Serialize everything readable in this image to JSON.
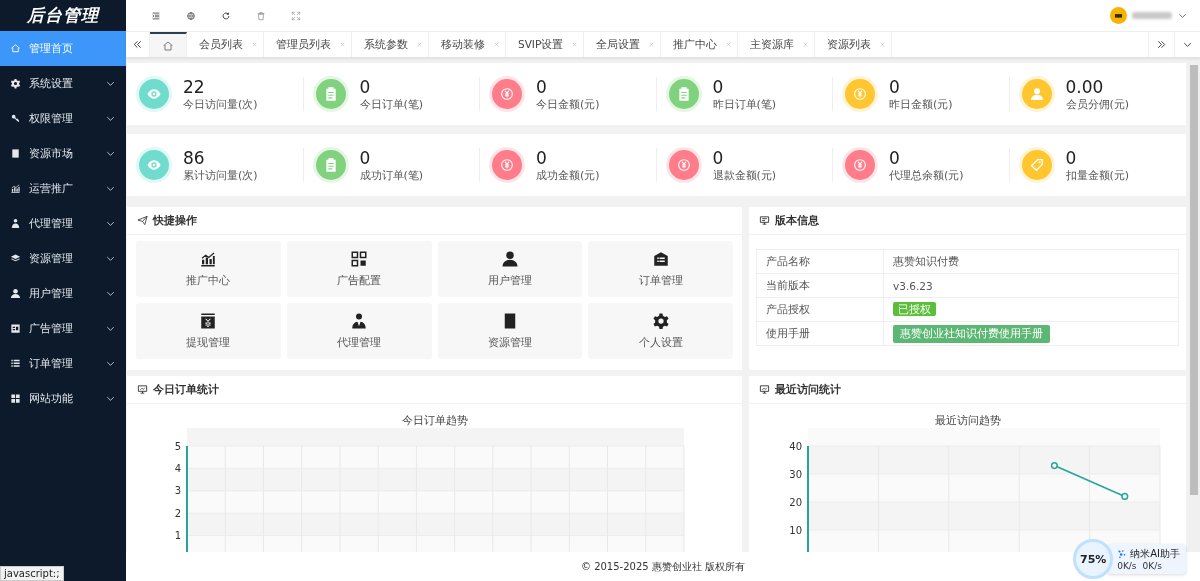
{
  "sidebar": {
    "logo": "后台管理",
    "items": [
      {
        "label": "管理首页",
        "selected": true,
        "expandable": false
      },
      {
        "label": "系统设置",
        "selected": false,
        "expandable": true
      },
      {
        "label": "权限管理",
        "selected": false,
        "expandable": true
      },
      {
        "label": "资源市场",
        "selected": false,
        "expandable": true
      },
      {
        "label": "运营推广",
        "selected": false,
        "expandable": true
      },
      {
        "label": "代理管理",
        "selected": false,
        "expandable": true
      },
      {
        "label": "资源管理",
        "selected": false,
        "expandable": true
      },
      {
        "label": "用户管理",
        "selected": false,
        "expandable": true
      },
      {
        "label": "广告管理",
        "selected": false,
        "expandable": true
      },
      {
        "label": "订单管理",
        "selected": false,
        "expandable": true
      },
      {
        "label": "网站功能",
        "selected": false,
        "expandable": true
      }
    ]
  },
  "home_tab": {
    "selected": true
  },
  "tabs": [
    {
      "label": "会员列表",
      "selected": false
    },
    {
      "label": "管理员列表",
      "selected": false
    },
    {
      "label": "系统参数",
      "selected": false
    },
    {
      "label": "移动装修",
      "selected": false
    },
    {
      "label": "SVIP设置",
      "selected": false
    },
    {
      "label": "全局设置",
      "selected": false
    },
    {
      "label": "推广中心",
      "selected": false
    },
    {
      "label": "主资源库",
      "selected": false
    },
    {
      "label": "资源列表",
      "selected": false
    }
  ],
  "stat_rows": [
    {
      "items": [
        {
          "value": "22",
          "label": "今日访问量(次)",
          "kind": "eye",
          "color": "#6fdccd"
        },
        {
          "value": "0",
          "label": "今日订单(笔)",
          "kind": "order",
          "color": "#80d27e"
        },
        {
          "value": "0",
          "label": "今日金额(元)",
          "kind": "yen",
          "color": "#ff7c8a"
        },
        {
          "value": "0",
          "label": "昨日订单(笔)",
          "kind": "order",
          "color": "#80d27e"
        },
        {
          "value": "0",
          "label": "昨日金额(元)",
          "kind": "yen",
          "color": "#ffc62f"
        },
        {
          "value": "0.00",
          "label": "会员分佣(元)",
          "kind": "user",
          "color": "#ffc62f"
        }
      ]
    },
    {
      "items": [
        {
          "value": "86",
          "label": "累计访问量(次)",
          "kind": "eye",
          "color": "#6fdccd"
        },
        {
          "value": "0",
          "label": "成功订单(笔)",
          "kind": "order",
          "color": "#80d27e"
        },
        {
          "value": "0",
          "label": "成功金额(元)",
          "kind": "yen",
          "color": "#ff7c8a"
        },
        {
          "value": "0",
          "label": "退款金额(元)",
          "kind": "yen",
          "color": "#ff7c8a"
        },
        {
          "value": "0",
          "label": "代理总余额(元)",
          "kind": "yen",
          "color": "#ff7c8a"
        },
        {
          "value": "0",
          "label": "扣量金额(元)",
          "kind": "tag",
          "color": "#ffc62f"
        }
      ]
    }
  ],
  "quick_actions": {
    "title": "快捷操作",
    "items": [
      {
        "label": "推广中心",
        "kind": "chart"
      },
      {
        "label": "广告配置",
        "kind": "grid"
      },
      {
        "label": "用户管理",
        "kind": "user"
      },
      {
        "label": "订单管理",
        "kind": "list"
      },
      {
        "label": "提现管理",
        "kind": "yen"
      },
      {
        "label": "代理管理",
        "kind": "agent"
      },
      {
        "label": "资源管理",
        "kind": "book"
      },
      {
        "label": "个人设置",
        "kind": "gear"
      }
    ]
  },
  "version_info": {
    "title": "版本信息",
    "rows": [
      {
        "label": "产品名称",
        "value": "惠赞知识付费",
        "kind": "text"
      },
      {
        "label": "当前版本",
        "value": "v3.6.23",
        "kind": "text"
      },
      {
        "label": "产品授权",
        "value": "已授权",
        "kind": "badge"
      },
      {
        "label": "使用手册",
        "value": "惠赞创业社知识付费使用手册",
        "kind": "button"
      }
    ]
  },
  "order_stats": {
    "title": "今日订单统计",
    "chart_data": {
      "type": "line",
      "title": "今日订单趋势",
      "categories": [
        null,
        null,
        null,
        null,
        null,
        null,
        null,
        null,
        null,
        null,
        null,
        null,
        null
      ],
      "ylim": [
        0,
        5
      ],
      "yticks": [
        1,
        2,
        3,
        4,
        5
      ],
      "grid": true
    }
  },
  "visit_stats": {
    "title": "最近访问统计",
    "chart_data": {
      "type": "line",
      "title": "最近访问趋势",
      "categories": [
        null,
        null,
        null,
        null,
        null
      ],
      "ylim": [
        0,
        40
      ],
      "yticks": [
        10,
        20,
        30,
        40
      ],
      "grid": true,
      "series": [
        {
          "color": "#26a69a",
          "marker": "circle",
          "values": [
            null,
            null,
            null,
            33,
            22
          ]
        }
      ]
    }
  },
  "footer": "© 2015-2025 惠赞创业社 版权所有",
  "status_tip": "javascript:;",
  "assistant_widget": {
    "percent": "75%",
    "title": "纳米AI助手",
    "upload": "0K/s",
    "download": "0K/s"
  }
}
